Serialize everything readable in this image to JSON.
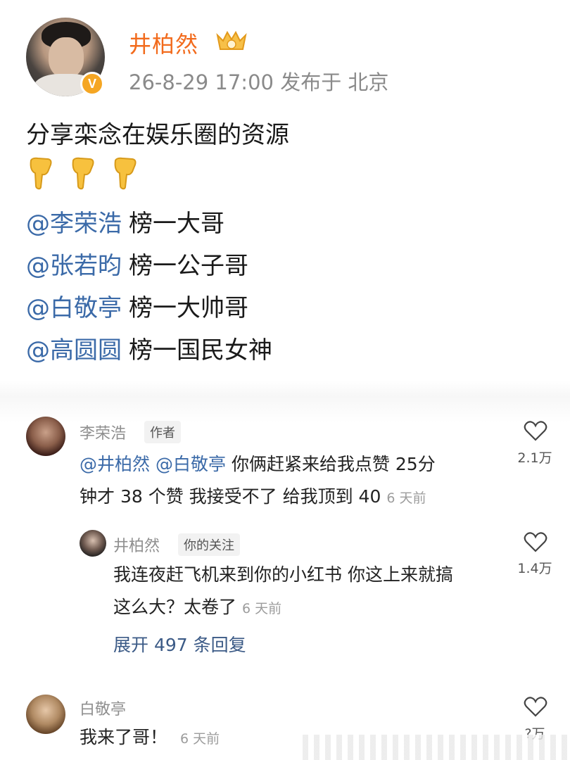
{
  "post": {
    "author": "井柏然",
    "meta": "26-8-29 17:00  发布于 北京",
    "text": "分享栾念在娱乐圈的资源",
    "verified_icon": "v-badge-icon",
    "vip_icon": "crown-badge-icon",
    "pointing_icons": [
      "point-down-hand-icon",
      "point-down-hand-icon",
      "point-down-hand-icon"
    ],
    "mentions": [
      {
        "name": "@李荣浩",
        "title": "榜一大哥"
      },
      {
        "name": "@张若昀",
        "title": "榜一公子哥"
      },
      {
        "name": "@白敬亭",
        "title": "榜一大帅哥"
      },
      {
        "name": "@高圆圆",
        "title": "榜一国民女神"
      }
    ]
  },
  "comments": [
    {
      "author": "李荣浩",
      "tag": "作者",
      "mention1": "@井柏然",
      "mention2": "@白敬亭",
      "line1_rest": "你俩赶紧来给我点赞  25分",
      "line2": "钟才 38 个赞 我接受不了 给我顶到 40",
      "time": "6 天前",
      "likes": "2.1万",
      "reply": {
        "author": "井柏然",
        "tag": "你的关注",
        "line1": "我连夜赶飞机来到你的小红书 你这上来就搞",
        "line2": "这么大？太卷了",
        "time": "6 天前",
        "likes": "1.4万"
      },
      "expand_label": "展开 497 条回复"
    },
    {
      "author": "白敬亭",
      "text": "我来了哥！",
      "time": "6 天前",
      "likes": "?万"
    }
  ],
  "colors": {
    "author_orange": "#f26b1d",
    "mention_blue": "#3b6aa8",
    "meta_gray": "#8a8a8a"
  }
}
